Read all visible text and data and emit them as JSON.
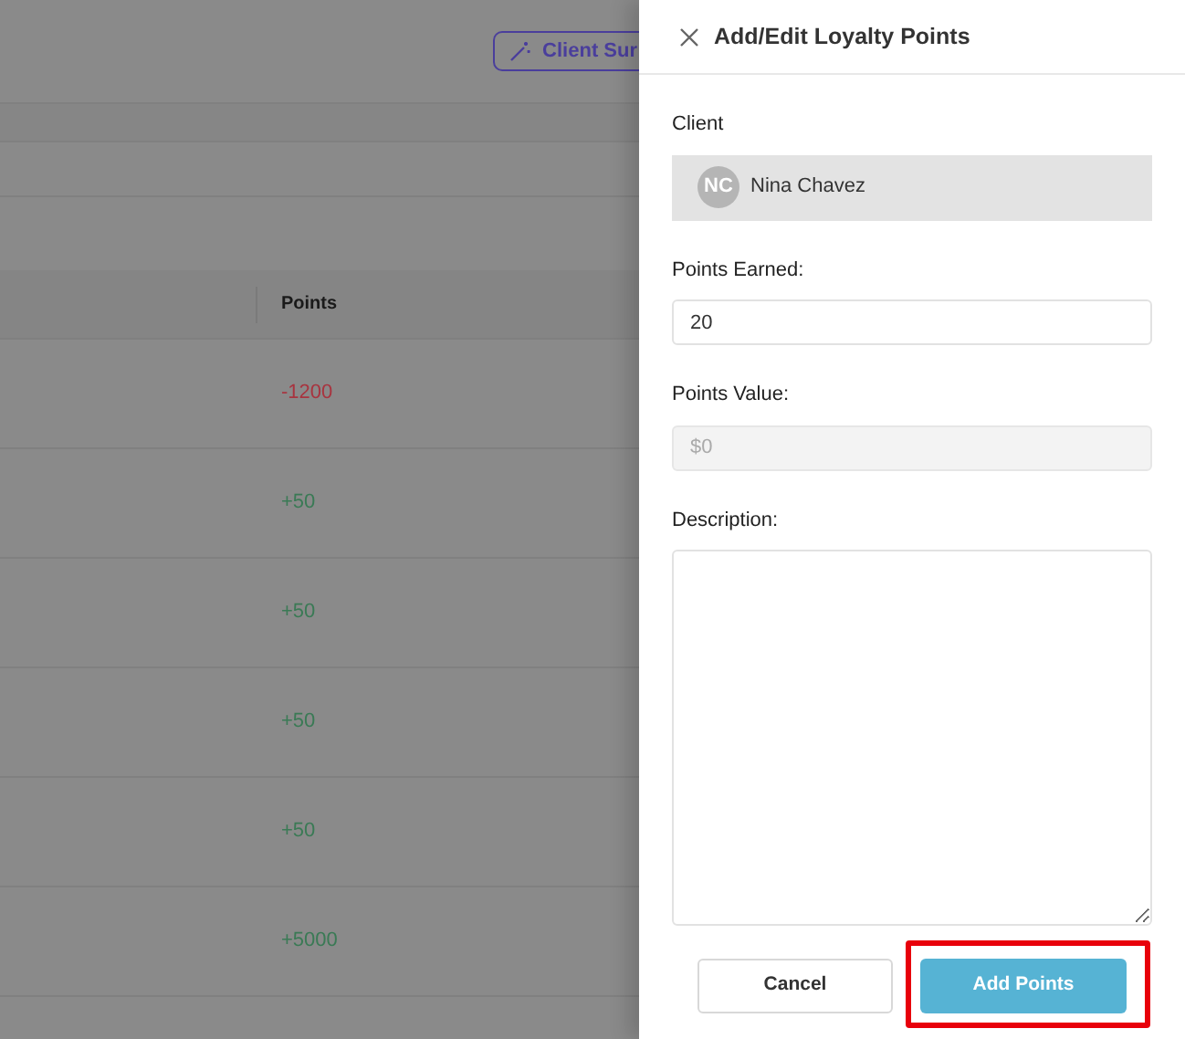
{
  "background": {
    "button": "Client Sur",
    "table": {
      "columns": [
        "Points"
      ],
      "rows": [
        {
          "points": "-1200",
          "kind": "negative"
        },
        {
          "points": "+50",
          "kind": "positive"
        },
        {
          "points": "+50",
          "kind": "positive"
        },
        {
          "points": "+50",
          "kind": "positive"
        },
        {
          "points": "+50",
          "kind": "positive"
        },
        {
          "points": "+5000",
          "kind": "positive"
        }
      ]
    }
  },
  "panel": {
    "title": "Add/Edit Loyalty Points",
    "client_label": "Client",
    "client": {
      "initials": "NC",
      "name": "Nina Chavez"
    },
    "points_earned": {
      "label": "Points Earned:",
      "value": "20"
    },
    "points_value": {
      "label": "Points Value:",
      "value": "$0",
      "disabled": true
    },
    "description": {
      "label": "Description:"
    },
    "buttons": [
      {
        "label": "Cancel",
        "kind": "secondary"
      },
      {
        "label": "Add Points",
        "kind": "primary"
      }
    ]
  }
}
